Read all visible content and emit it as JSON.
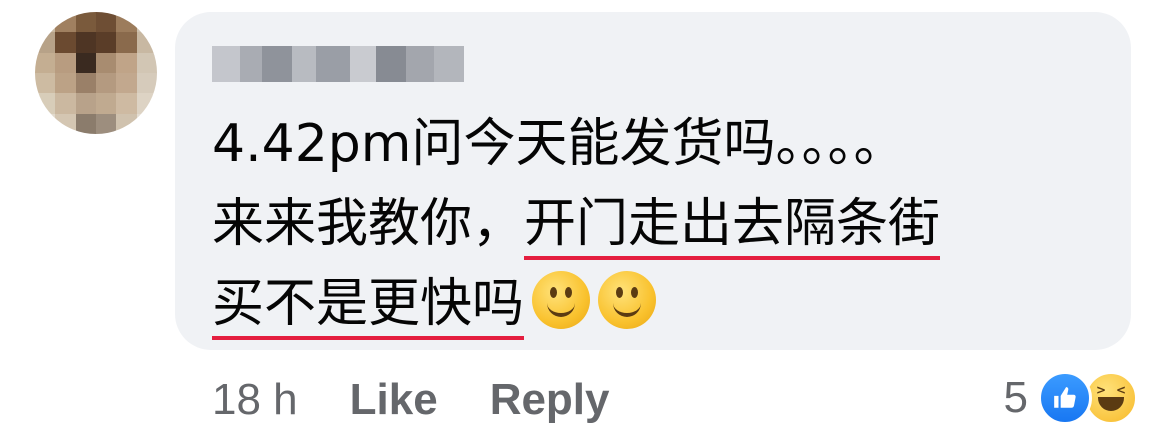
{
  "comment": {
    "author_name": "",
    "line1": "4.42pm问今天能发货吗。。。。",
    "line2_plain": "来来我教你，",
    "line2_underlined": "开门走出去隔条街",
    "line3_underlined": "买不是更快吗",
    "emojis": [
      "slightly-smiling-face-icon",
      "slightly-smiling-face-icon"
    ]
  },
  "actions": {
    "time": "18 h",
    "like_label": "Like",
    "reply_label": "Reply"
  },
  "reactions": {
    "count": "5",
    "types": [
      "like-icon",
      "haha-icon"
    ]
  },
  "colors": {
    "bubble_bg": "#f0f2f5",
    "text": "#050505",
    "meta_text": "#65676b",
    "underline": "#e41e3f",
    "like_blue": "#1877f2"
  }
}
